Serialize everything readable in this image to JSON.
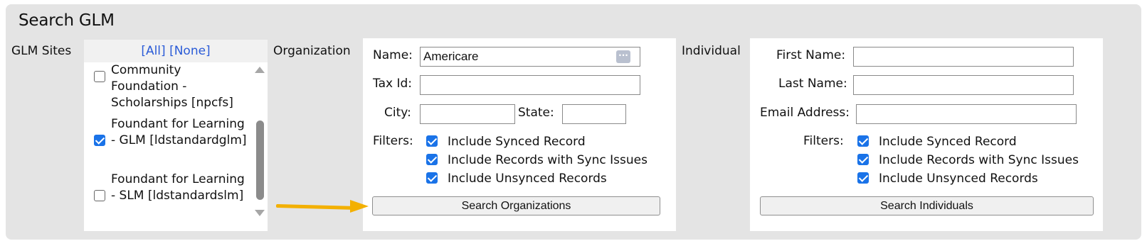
{
  "title": "Search GLM",
  "glm_sites": {
    "label": "GLM Sites",
    "all_link": "[All]",
    "none_link": "[None]",
    "items": [
      {
        "label": "Community Foundation - Scholarships [npcfs]",
        "checked": false
      },
      {
        "label": "Foundant for Learning - GLM [ldstandardglm]",
        "checked": true
      },
      {
        "label": "Foundant for Learning - SLM [ldstandardslm]",
        "checked": false
      }
    ]
  },
  "organization": {
    "label": "Organization",
    "name_label": "Name:",
    "name_value": "Americare",
    "tax_id_label": "Tax Id:",
    "tax_id_value": "",
    "city_label": "City:",
    "city_value": "",
    "state_label": "State:",
    "state_value": "",
    "filters_label": "Filters:",
    "filters": [
      {
        "label": "Include Synced Record",
        "checked": true
      },
      {
        "label": "Include Records with Sync Issues",
        "checked": true
      },
      {
        "label": "Include Unsynced Records",
        "checked": true
      }
    ],
    "search_button": "Search Organizations"
  },
  "individual": {
    "label": "Individual",
    "first_name_label": "First Name:",
    "first_name_value": "",
    "last_name_label": "Last Name:",
    "last_name_value": "",
    "email_label": "Email Address:",
    "email_value": "",
    "filters_label": "Filters:",
    "filters": [
      {
        "label": "Include Synced Record",
        "checked": true
      },
      {
        "label": "Include Records with Sync Issues",
        "checked": true
      },
      {
        "label": "Include Unsynced Records",
        "checked": true
      }
    ],
    "search_button": "Search Individuals"
  },
  "colors": {
    "panel_bg": "#e4e4e4",
    "link": "#2a5bd7",
    "checkbox": "#1a73e8",
    "annotation_arrow": "#f3b000"
  },
  "icons": {
    "lookup": "ellipsis-icon",
    "arrow": "annotation-arrow-icon"
  }
}
